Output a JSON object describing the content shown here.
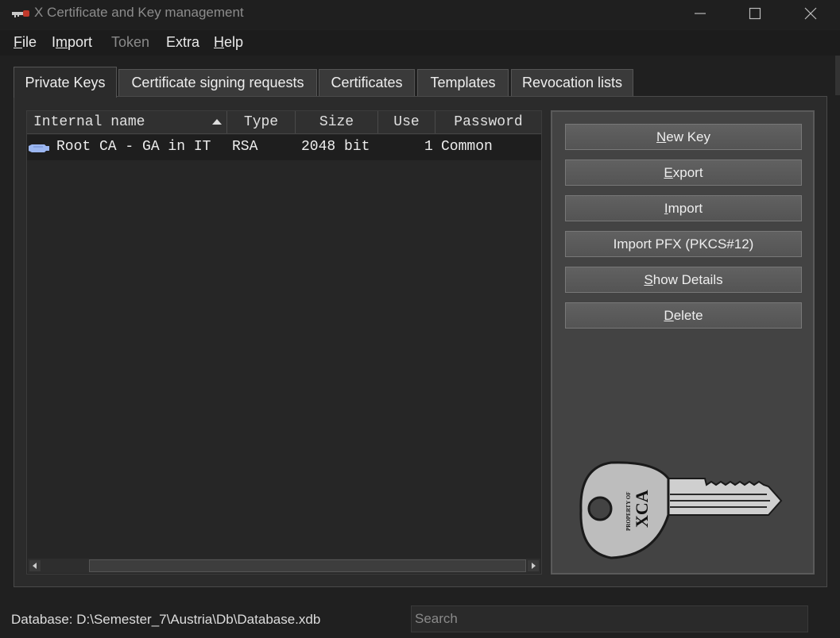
{
  "window": {
    "title": "X Certificate and Key management"
  },
  "menu": {
    "file": {
      "ul": "F",
      "rest": "ile"
    },
    "import": {
      "pre": "I",
      "ul": "m",
      "rest": "port"
    },
    "token": "Token",
    "extra": "Extra",
    "help": {
      "ul": "H",
      "rest": "elp"
    }
  },
  "tabs": [
    {
      "label": "Private Keys"
    },
    {
      "label": "Certificate signing requests"
    },
    {
      "label": "Certificates"
    },
    {
      "label": "Templates"
    },
    {
      "label": "Revocation lists"
    }
  ],
  "columns": [
    "Internal name",
    "Type",
    "Size",
    "Use",
    "Password"
  ],
  "rows": [
    {
      "name": "Root CA - GA in IT",
      "type": "RSA",
      "size": "2048 bit",
      "use": "1",
      "password": "Common"
    }
  ],
  "buttons": {
    "new_key": {
      "ul": "N",
      "rest": "ew Key"
    },
    "export": {
      "ul": "E",
      "rest": "xport"
    },
    "import": {
      "ul": "I",
      "rest": "mport"
    },
    "import_pfx": "Import PFX (PKCS#12)",
    "show_details": {
      "ul": "S",
      "rest": "how Details"
    },
    "delete": {
      "ul": "D",
      "rest": "elete"
    }
  },
  "key_image": {
    "line1": "PROPERTY OF",
    "line2": "XCA"
  },
  "status": {
    "database": "Database: D:\\Semester_7\\Austria\\Db\\Database.xdb",
    "search_placeholder": "Search"
  },
  "colors": {
    "background": "#202020",
    "panel": "#2b2b2b",
    "button": "#5c5c5c",
    "row_selected": "#1e1e1e"
  }
}
